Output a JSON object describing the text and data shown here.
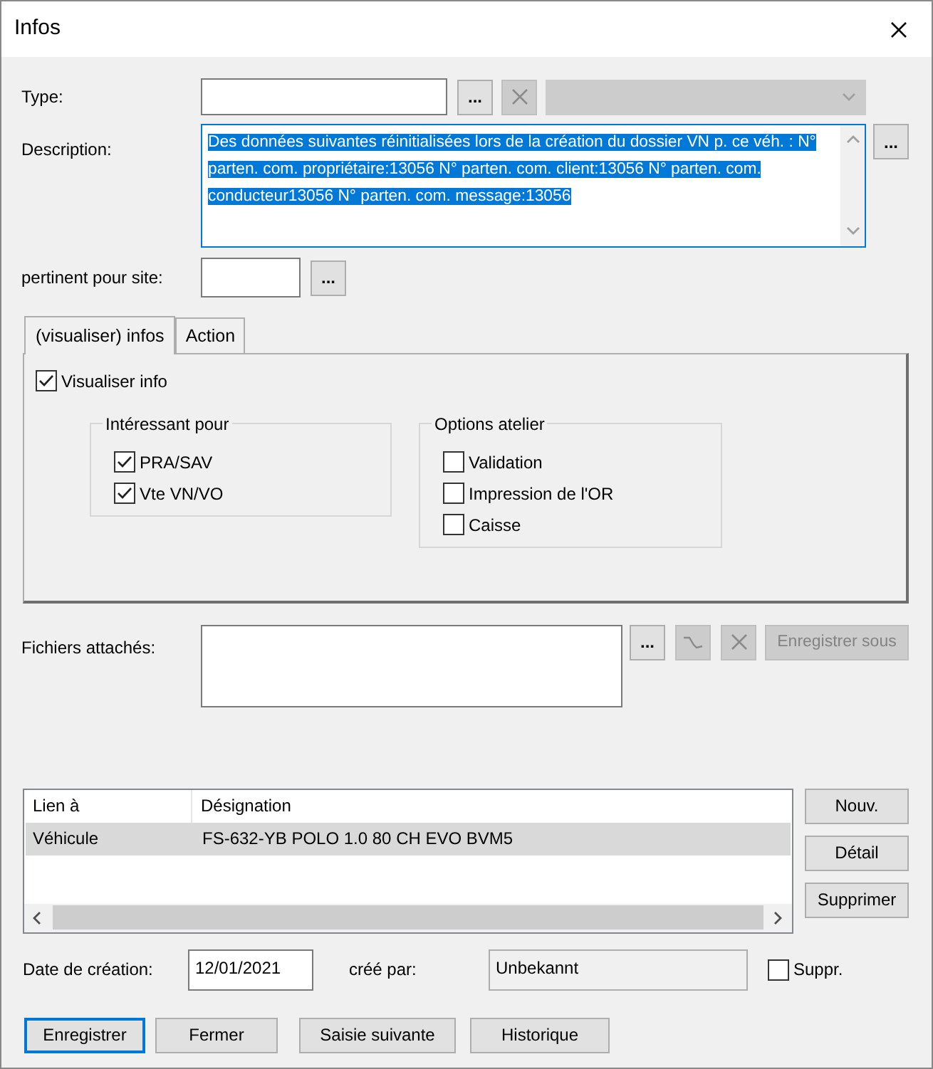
{
  "window": {
    "title": "Infos"
  },
  "type": {
    "label": "Type:",
    "value_disabled": false,
    "browse": "...",
    "list_disabled": true,
    "clear_disabled": true
  },
  "description": {
    "label": "Description:",
    "text": "Des données suivantes réinitialisées lors de la création du dossier VN p. ce véh. : N° parten. com. propriétaire:13056 N° parten. com. client:13056 N° parten. com. conducteur13056 N° parten. com. message:13056",
    "selected": true,
    "browse": "..."
  },
  "site": {
    "label": "pertinent pour site:",
    "browse": "..."
  },
  "tabs": [
    {
      "label": "(visualiser) infos",
      "selected": true
    },
    {
      "label": "Action",
      "selected": false
    }
  ],
  "visualiser": {
    "label": "Visualiser info",
    "checked": true
  },
  "groups": [
    {
      "title": "Intéressant pour",
      "items": [
        {
          "label": "PRA/SAV",
          "checked": true
        },
        {
          "label": "Vte VN/VO",
          "checked": true
        }
      ]
    },
    {
      "title": "Options atelier",
      "items": [
        {
          "label": "Validation",
          "checked": false
        },
        {
          "label": "Impression de l'OR",
          "checked": false
        },
        {
          "label": "Caisse",
          "checked": false
        }
      ]
    }
  ],
  "attachments": {
    "label": "Fichiers attachés:",
    "browse": "...",
    "link_disabled": true,
    "delete_disabled": true,
    "save_as": {
      "label": "Enregistrer sous",
      "disabled": true
    }
  },
  "table": {
    "columns": [
      "Lien à",
      "Désignation"
    ],
    "rows": [
      {
        "cells": [
          "Véhicule",
          "FS-632-YB POLO 1.0 80 CH EVO BVM5"
        ],
        "selected": true
      }
    ]
  },
  "side_buttons": [
    "Nouv.",
    "Détail",
    "Supprimer"
  ],
  "creation": {
    "label": "Date de création:",
    "value": "12/01/2021",
    "by_label": "créé par:",
    "by_value": "Unbekannt",
    "delete": {
      "label": "Suppr.",
      "checked": false
    }
  },
  "buttons": [
    {
      "label": "Enregistrer",
      "focused": true
    },
    {
      "label": "Fermer",
      "focused": false
    },
    {
      "label": "Saisie suivante",
      "focused": false
    },
    {
      "label": "Historique",
      "focused": false
    }
  ]
}
